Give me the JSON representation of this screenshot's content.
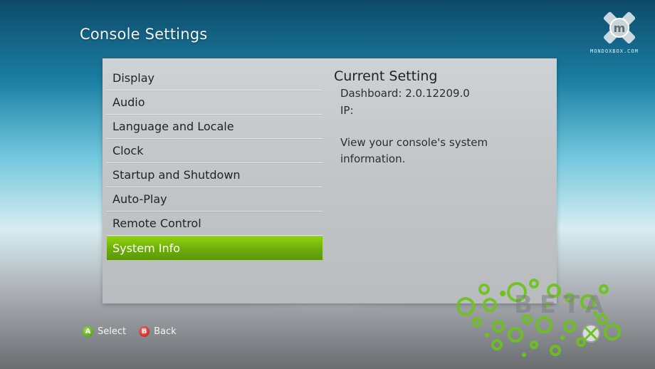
{
  "header": {
    "title": "Console Settings"
  },
  "menu": {
    "items": [
      {
        "label": "Display"
      },
      {
        "label": "Audio"
      },
      {
        "label": "Language and Locale"
      },
      {
        "label": "Clock"
      },
      {
        "label": "Startup and Shutdown"
      },
      {
        "label": "Auto-Play"
      },
      {
        "label": "Remote Control"
      },
      {
        "label": "System Info"
      }
    ],
    "selected": "System Info"
  },
  "detail": {
    "heading": "Current Setting",
    "dashboard": "Dashboard: 2.0.12209.0",
    "ip": "IP:",
    "description": "View your console's system information."
  },
  "footer": {
    "a_glyph": "A",
    "a_label": "Select",
    "b_glyph": "B",
    "b_label": "Back"
  },
  "watermark": {
    "site": "MONDOXBOX.COM",
    "beta": "BETA"
  },
  "colors": {
    "accent_green": "#6cad0a",
    "button_a": "#3f8f10",
    "button_b": "#b41616"
  }
}
